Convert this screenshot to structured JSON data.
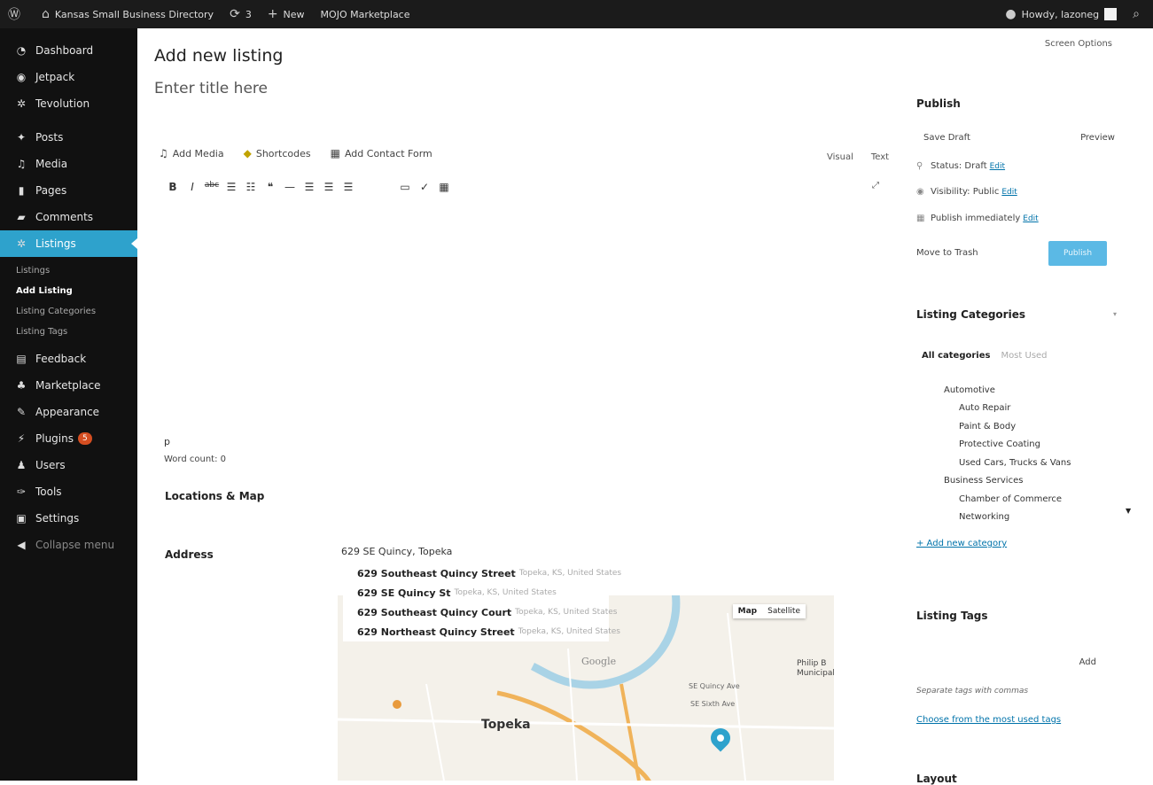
{
  "adminbar": {
    "wp_logo": "wordpress-icon",
    "site_name": "Kansas Small Business Directory",
    "updates_count": "3",
    "new_label": "New",
    "marketplace": "MOJO Marketplace",
    "howdy": "Howdy, lazoneg"
  },
  "sidebar": {
    "dashboard": "Dashboard",
    "jetpack": "Jetpack",
    "tevolution": "Tevolution",
    "posts": "Posts",
    "media": "Media",
    "pages": "Pages",
    "comments": "Comments",
    "listings": "Listings",
    "submenu": {
      "listings": "Listings",
      "add_listing": "Add Listing",
      "listing_categories": "Listing Categories",
      "listing_tags": "Listing Tags"
    },
    "feedback": "Feedback",
    "marketplace": "Marketplace",
    "appearance": "Appearance",
    "plugins": "Plugins",
    "plugins_badge": "5",
    "users": "Users",
    "tools": "Tools",
    "settings": "Settings",
    "collapse": "Collapse menu"
  },
  "main": {
    "screen_options": "Screen Options",
    "page_title": "Add new listing",
    "title_placeholder": "Enter title here",
    "add_media": "Add Media",
    "shortcodes": "Shortcodes",
    "add_contact_form": "Add Contact Form",
    "tab_visual": "Visual",
    "tab_text": "Text",
    "editor_path": "p",
    "word_count": "Word count: 0",
    "locations_title": "Locations & Map",
    "address_label": "Address",
    "address_value": "629 SE Quincy, Topeka",
    "autocomplete": [
      {
        "main": "629 Southeast Quincy Street",
        "secondary": "Topeka, KS, United States"
      },
      {
        "main": "629 SE Quincy St",
        "secondary": "Topeka, KS, United States"
      },
      {
        "main": "629 Southeast Quincy Court",
        "secondary": "Topeka, KS, United States"
      },
      {
        "main": "629 Northeast Quincy Street",
        "secondary": "Topeka, KS, United States"
      }
    ],
    "map": {
      "type_map": "Map",
      "type_satellite": "Satellite",
      "city": "Topeka",
      "google": "Google",
      "poi": "Philip B Municipal",
      "street_1": "SE Quincy Ave",
      "street_2": "SE Sixth Ave"
    }
  },
  "publish": {
    "title": "Publish",
    "save_draft": "Save Draft",
    "preview": "Preview",
    "status": "Status: Draft",
    "visibility": "Visibility: Public",
    "schedule": "Publish immediately",
    "edit": "Edit",
    "trash": "Move to Trash",
    "publish_button": "Publish"
  },
  "categories": {
    "title": "Listing Categories",
    "tab_all": "All categories",
    "tab_most_used": "Most Used",
    "items": [
      {
        "label": "Automotive",
        "level": 0
      },
      {
        "label": "Auto Repair",
        "level": 1
      },
      {
        "label": "Paint & Body",
        "level": 1
      },
      {
        "label": "Protective Coating",
        "level": 1
      },
      {
        "label": "Used Cars, Trucks & Vans",
        "level": 1
      },
      {
        "label": "Business Services",
        "level": 0
      },
      {
        "label": "Chamber of Commerce",
        "level": 1
      },
      {
        "label": "Networking",
        "level": 1
      }
    ],
    "add_new": "+ Add new category"
  },
  "tags": {
    "title": "Listing Tags",
    "add": "Add",
    "help": "Separate tags with commas",
    "choose": "Choose from the most used tags"
  },
  "layout": {
    "title": "Layout"
  }
}
